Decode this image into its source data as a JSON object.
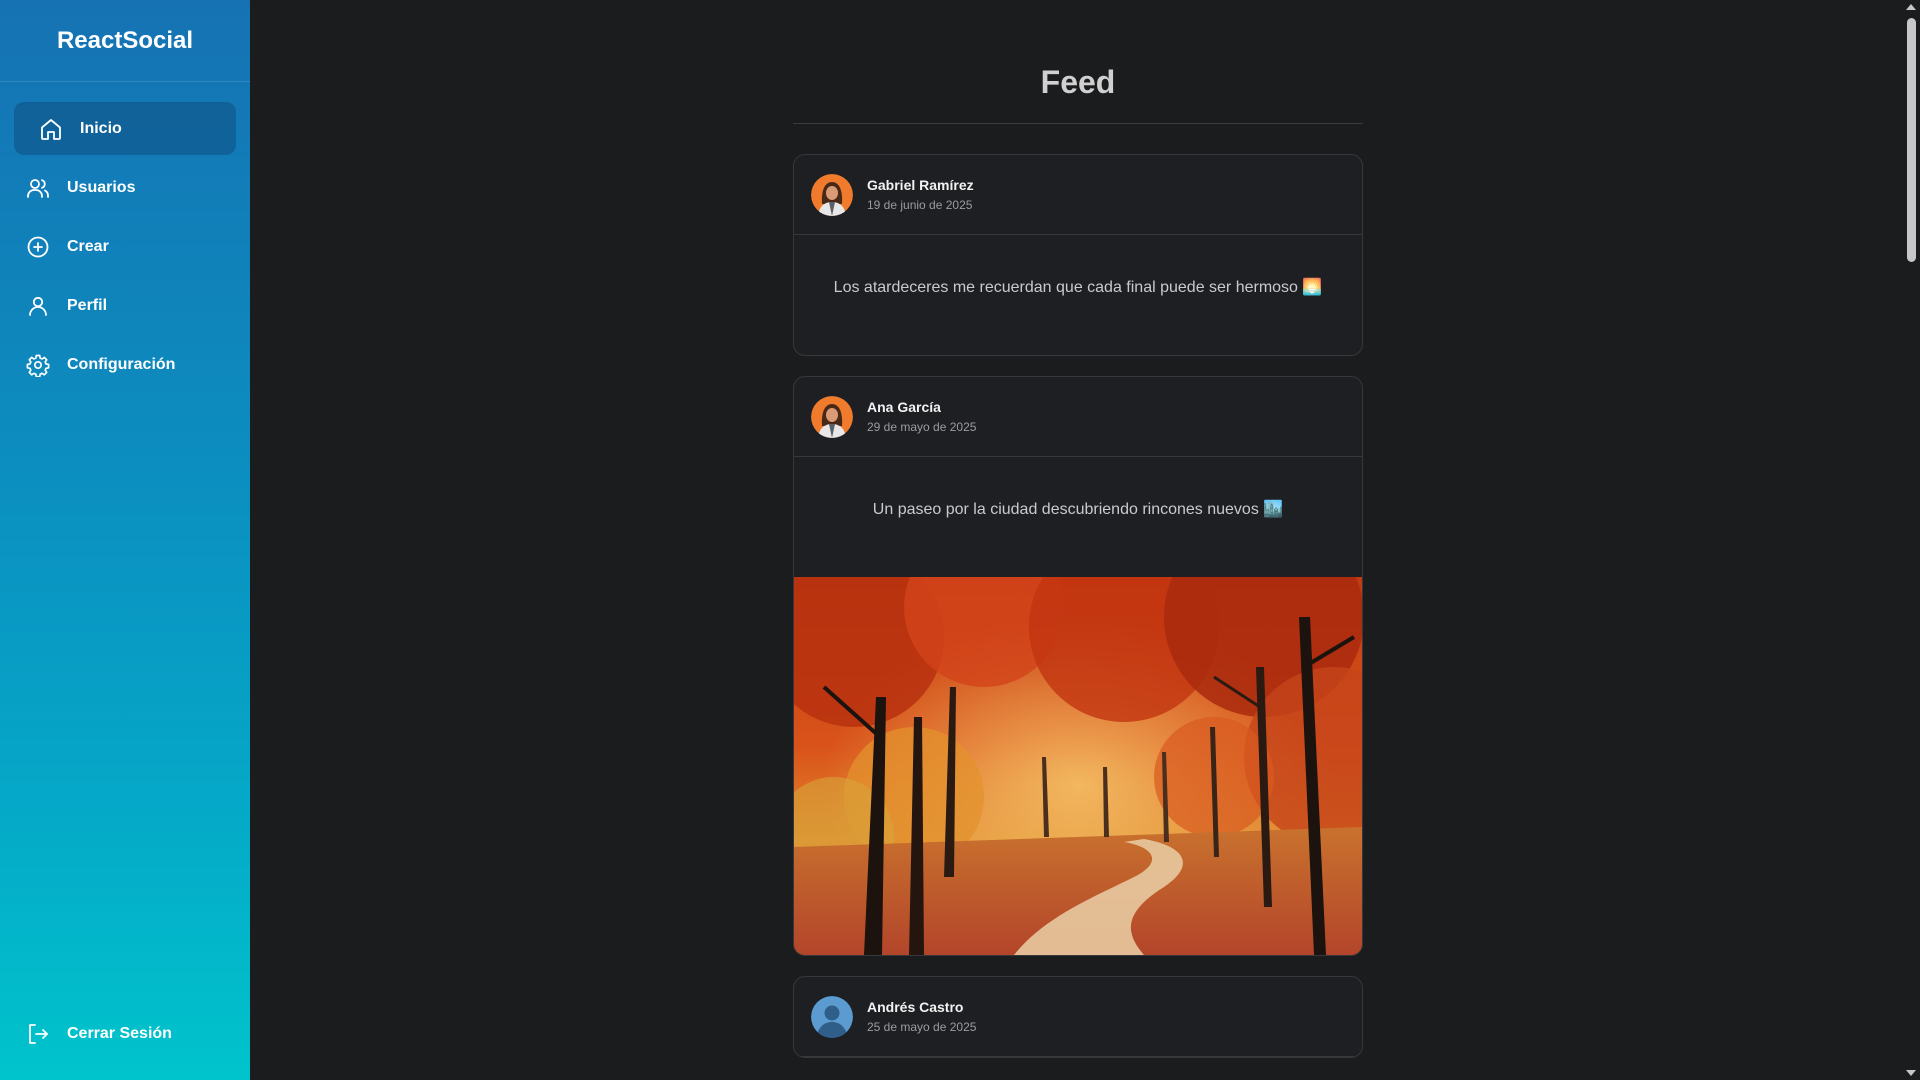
{
  "sidebar": {
    "brand": "ReactSocial",
    "items": [
      {
        "label": "Inicio",
        "icon": "home-icon"
      },
      {
        "label": "Usuarios",
        "icon": "users-icon"
      },
      {
        "label": "Crear",
        "icon": "plus-circle-icon"
      },
      {
        "label": "Perfil",
        "icon": "user-icon"
      },
      {
        "label": "Configuración",
        "icon": "gear-icon"
      }
    ],
    "active": "Inicio",
    "logout": {
      "label": "Cerrar Sesión",
      "icon": "logout-icon"
    }
  },
  "feed": {
    "title": "Feed",
    "posts": [
      {
        "author": "Gabriel Ramírez",
        "date": "19 de junio de 2025",
        "text": "Los atardeceres me recuerdan que cada final puede ser hermoso 🌅",
        "avatar": "female-avatar-icon"
      },
      {
        "author": "Ana García",
        "date": "29 de mayo de 2025",
        "text": "Un paseo por la ciudad descubriendo rincones nuevos 🏙️",
        "avatar": "female-avatar-icon",
        "image": "autumn forest path photo"
      },
      {
        "author": "Andrés Castro",
        "date": "25 de mayo de 2025",
        "avatar": "male-avatar-icon"
      }
    ]
  },
  "colors": {
    "sidebar_top": "#1672b3",
    "sidebar_bottom": "#00c4cc",
    "background": "#1b1c1e",
    "card": "#1e1f22",
    "border": "#36383c"
  }
}
